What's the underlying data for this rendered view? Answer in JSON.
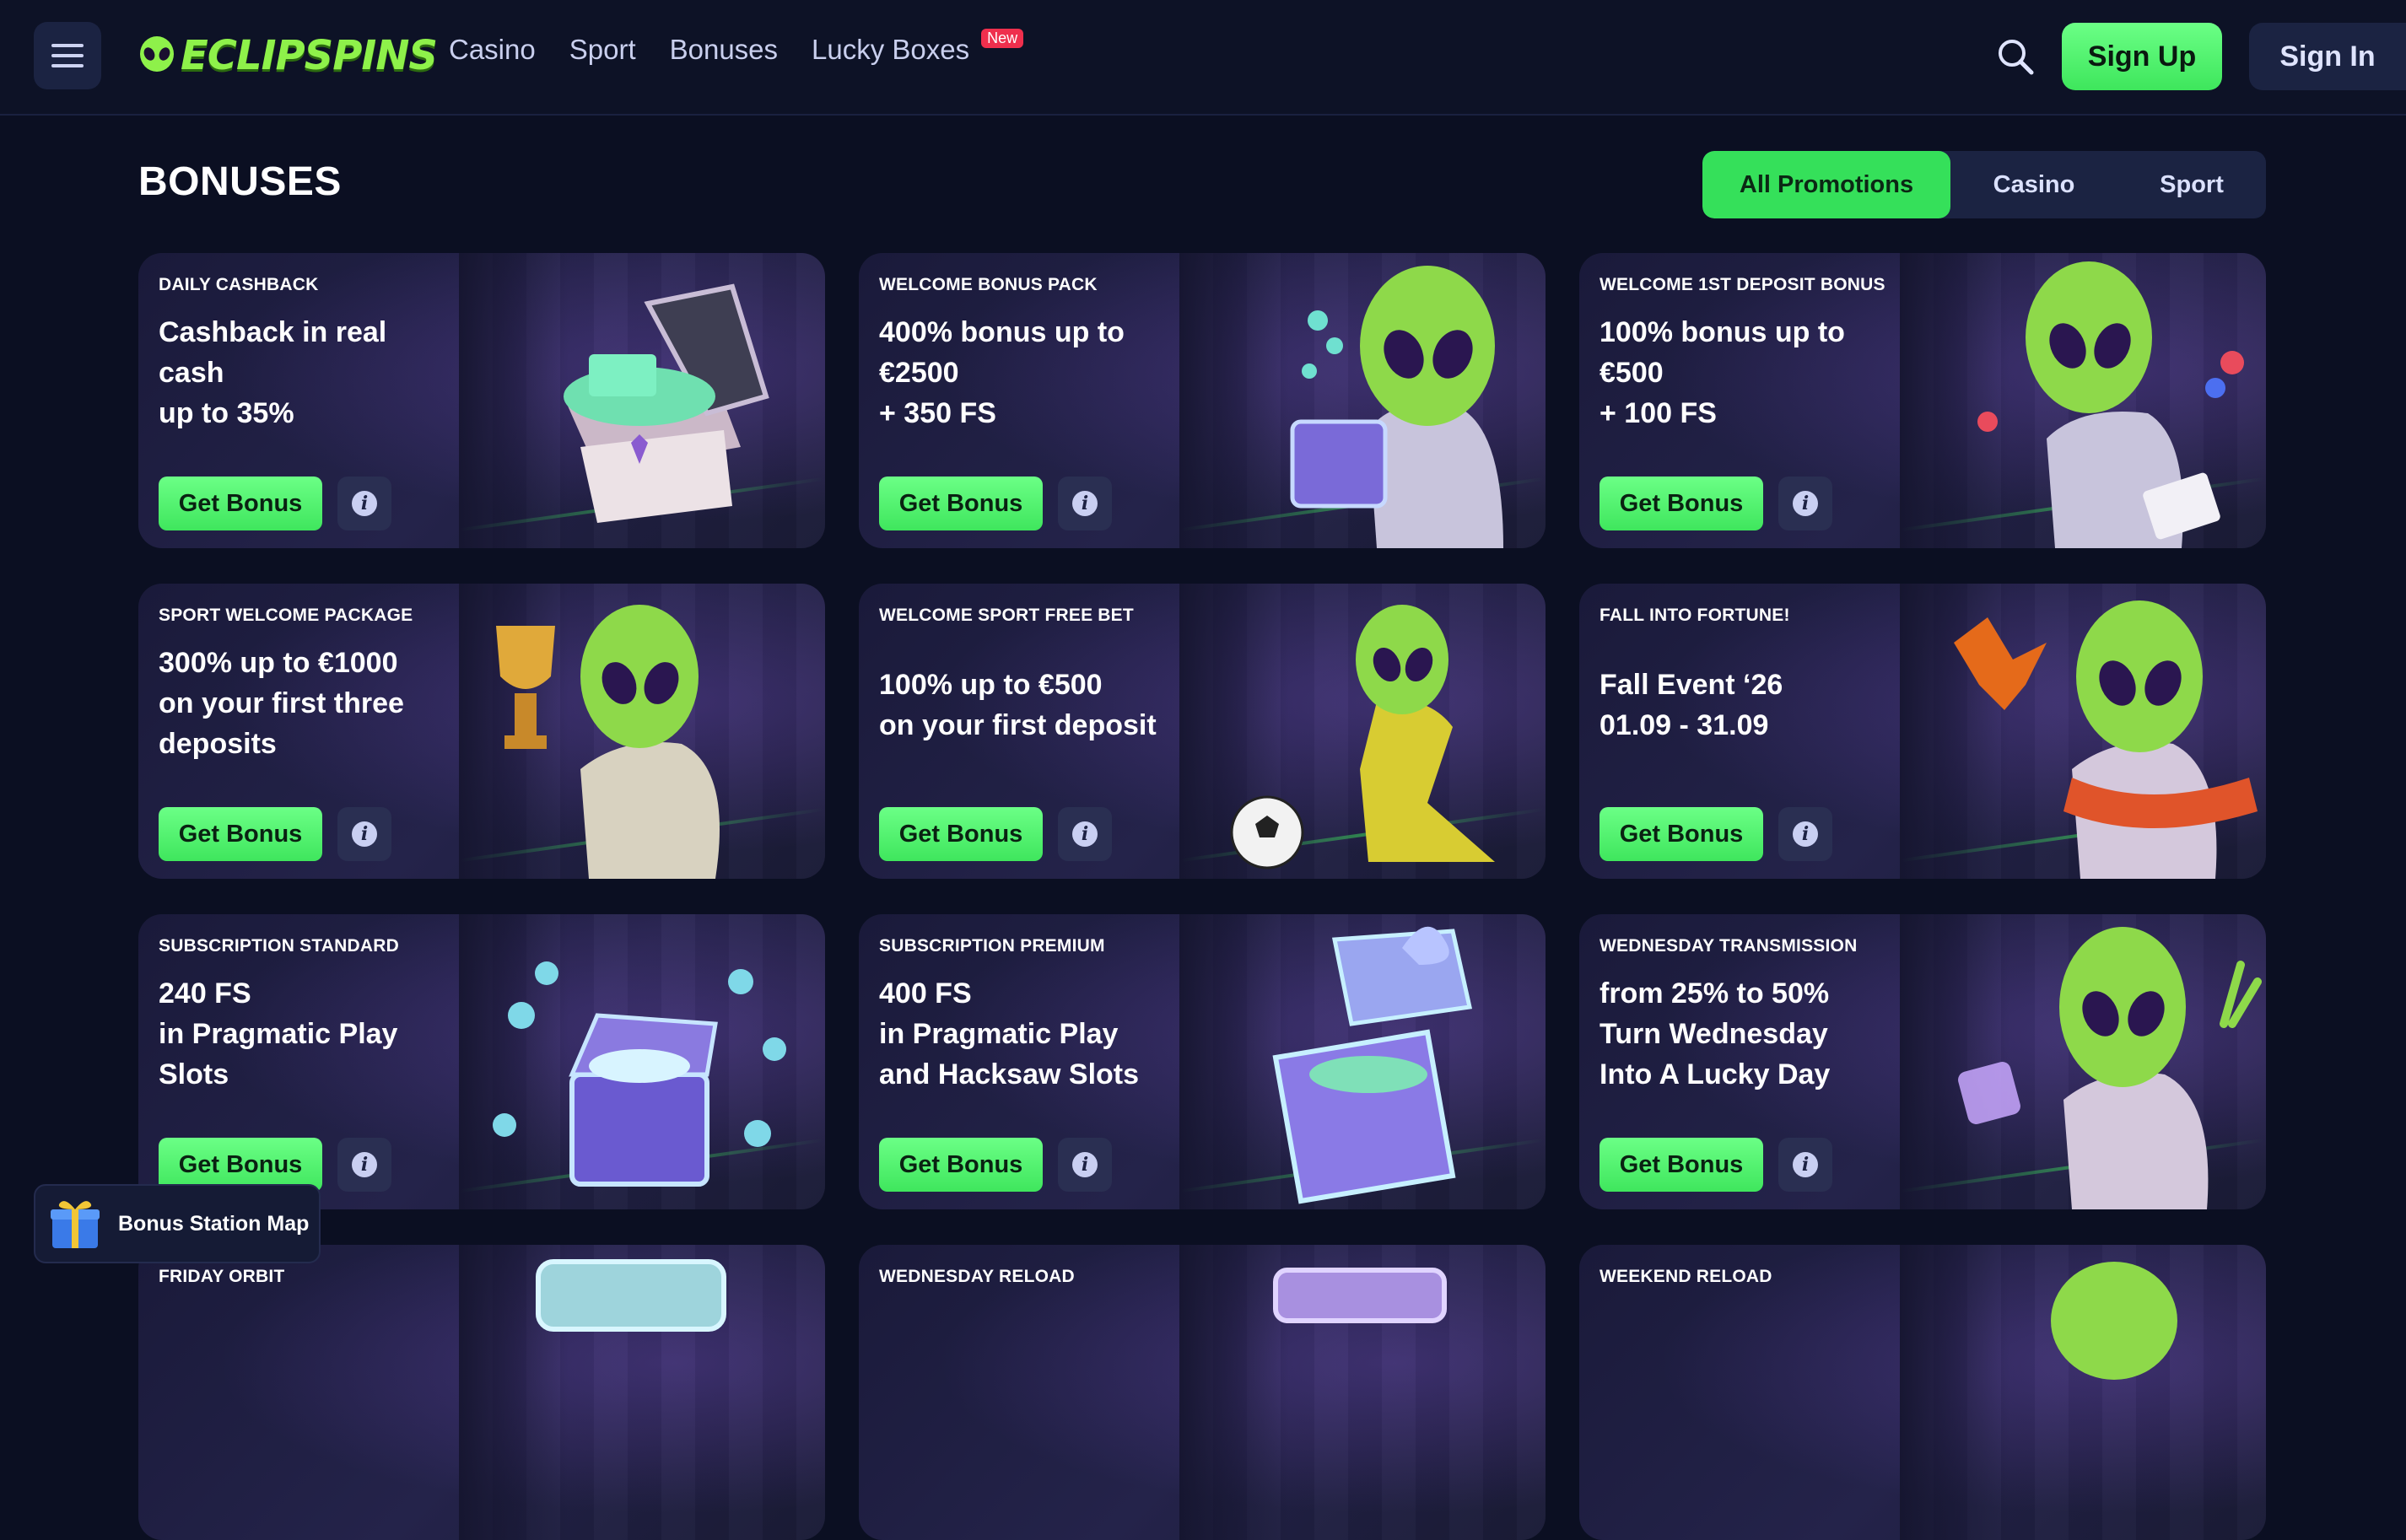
{
  "header": {
    "logo_text": "ECLIPSPINS",
    "nav": [
      {
        "label": "Casino"
      },
      {
        "label": "Sport"
      },
      {
        "label": "Bonuses"
      },
      {
        "label": "Lucky Boxes",
        "badge": "New"
      }
    ],
    "search_icon": "search-icon",
    "signup_label": "Sign Up",
    "signin_label": "Sign In"
  },
  "page": {
    "title": "BONUSES",
    "filters": [
      {
        "label": "All Promotions",
        "active": true
      },
      {
        "label": "Casino",
        "active": false
      },
      {
        "label": "Sport",
        "active": false
      }
    ]
  },
  "cards": [
    {
      "category": "DAILY CASHBACK",
      "title_lines": [
        "Cashback in real",
        "cash",
        "up to 35%"
      ],
      "button": "Get Bonus",
      "art": "treasure-chest"
    },
    {
      "category": "WELCOME BONUS PACK",
      "title_lines": [
        "400% bonus up to",
        "€2500",
        "+ 350 FS"
      ],
      "button": "Get Bonus",
      "art": "alien-with-box"
    },
    {
      "category": "WELCOME 1ST DEPOSIT BONUS",
      "title_lines": [
        "100% bonus up to",
        "€500",
        "+ 100 FS"
      ],
      "button": "Get Bonus",
      "art": "alien-with-cards"
    },
    {
      "category": "SPORT WELCOME PACKAGE",
      "title_lines": [
        "300% up to €1000",
        "on your first three",
        "deposits"
      ],
      "button": "Get Bonus",
      "art": "alien-with-trophy"
    },
    {
      "category": "WELCOME SPORT FREE BET",
      "title_lines": [
        "100% up to €500",
        "on your first deposit"
      ],
      "button": "Get Bonus",
      "art": "alien-football"
    },
    {
      "category": "FALL INTO FORTUNE!",
      "title_lines": [
        "Fall Event ‘26",
        "01.09 - 31.09"
      ],
      "button": "Get Bonus",
      "art": "alien-autumn"
    },
    {
      "category": "SUBSCRIPTION STANDARD",
      "title_lines": [
        "240 FS",
        "in Pragmatic Play",
        "Slots"
      ],
      "button": "Get Bonus",
      "art": "coin-chest"
    },
    {
      "category": "SUBSCRIPTION PREMIUM",
      "title_lines": [
        "400 FS",
        "in Pragmatic Play",
        "and Hacksaw Slots"
      ],
      "button": "Get Bonus",
      "art": "gift-box"
    },
    {
      "category": "WEDNESDAY TRANSMISSION",
      "title_lines": [
        "from 25% to 50%",
        "Turn Wednesday",
        "Into A Lucky Day"
      ],
      "button": "Get Bonus",
      "art": "alien-dice"
    },
    {
      "category": "FRIDAY ORBIT",
      "title_lines": [],
      "button": "",
      "art": "machine"
    },
    {
      "category": "WEDNESDAY RELOAD",
      "title_lines": [],
      "button": "",
      "art": "chest-top"
    },
    {
      "category": "WEEKEND RELOAD",
      "title_lines": [],
      "button": "",
      "art": "alien-head"
    }
  ],
  "bonus_station": {
    "label": "Bonus Station Map",
    "icon": "gift-icon"
  },
  "colors": {
    "accent": "#3ee65c",
    "background": "#0b0f22",
    "panel": "#1b2342",
    "new_badge": "#ef2f4d"
  }
}
